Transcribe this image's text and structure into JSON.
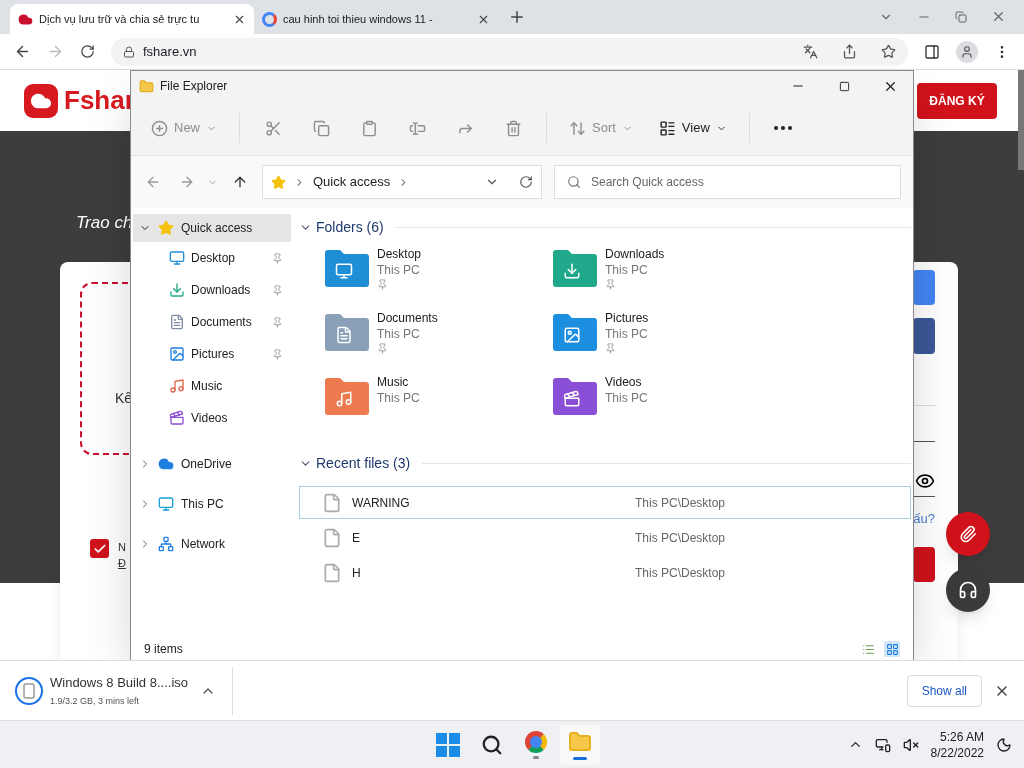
{
  "browser": {
    "tabs": [
      {
        "title": "Dịch vụ lưu trữ và chia sẻ trực tu",
        "selected": true
      },
      {
        "title": "cau hinh toi thieu windows 11 -",
        "selected": false
      }
    ],
    "address": "fshare.vn"
  },
  "page": {
    "logo": "Fshar",
    "register_button": "ĐĂNG KÝ",
    "tagline": "Trao ch",
    "drop_zone_text": "Kế",
    "agree": {
      "checked": true,
      "line_1": "N",
      "line_2": "Đ"
    },
    "link_text": "ấu?"
  },
  "explorer": {
    "title": "File Explorer",
    "toolbar": [
      {
        "kind": "new",
        "label": "New",
        "disabled": true
      },
      {
        "kind": "cut",
        "disabled": true
      },
      {
        "kind": "copy",
        "disabled": true
      },
      {
        "kind": "paste",
        "disabled": true
      },
      {
        "kind": "rename",
        "disabled": true
      },
      {
        "kind": "share",
        "disabled": true
      },
      {
        "kind": "delete",
        "disabled": true
      },
      {
        "kind": "sort",
        "label": "Sort",
        "disabled": true
      },
      {
        "kind": "view",
        "label": "View",
        "disabled": false
      },
      {
        "kind": "more",
        "disabled": false
      }
    ],
    "breadcrumb": "Quick access",
    "search_placeholder": "Search Quick access",
    "sidebar": [
      {
        "kind": "quick",
        "label": "Quick access",
        "expanded": true,
        "selected": true,
        "children": [
          {
            "kind": "desktop",
            "label": "Desktop",
            "pinned": true,
            "selected": false
          },
          {
            "kind": "downloads",
            "label": "Downloads",
            "pinned": true,
            "selected": false
          },
          {
            "kind": "documents",
            "label": "Documents",
            "pinned": true,
            "selected": false
          },
          {
            "kind": "pictures",
            "label": "Pictures",
            "pinned": true,
            "selected": false
          },
          {
            "kind": "music",
            "label": "Music",
            "pinned": false,
            "selected": false
          },
          {
            "kind": "videos",
            "label": "Videos",
            "pinned": false,
            "selected": false
          }
        ]
      },
      {
        "kind": "onedrive",
        "label": "OneDrive",
        "expanded": false,
        "selected": false
      },
      {
        "kind": "pc",
        "label": "This PC",
        "expanded": false,
        "selected": false
      },
      {
        "kind": "network",
        "label": "Network",
        "expanded": false,
        "selected": false
      }
    ],
    "folders": {
      "title": "Folders (6)",
      "expanded": true,
      "items": [
        {
          "kind": "desktop",
          "name": "Desktop",
          "location": "This PC",
          "pinned": true
        },
        {
          "kind": "downloads",
          "name": "Downloads",
          "location": "This PC",
          "pinned": true
        },
        {
          "kind": "documents",
          "name": "Documents",
          "location": "This PC",
          "pinned": true
        },
        {
          "kind": "pictures",
          "name": "Pictures",
          "location": "This PC",
          "pinned": true
        },
        {
          "kind": "music",
          "name": "Music",
          "location": "This PC",
          "pinned": false
        },
        {
          "kind": "videos",
          "name": "Videos",
          "location": "This PC",
          "pinned": false
        }
      ]
    },
    "recent": {
      "title": "Recent files (3)",
      "expanded": true,
      "items": [
        {
          "name": "WARNING",
          "location": "This PC\\Desktop",
          "selected": true
        },
        {
          "name": "E",
          "location": "This PC\\Desktop",
          "selected": false
        },
        {
          "name": "H",
          "location": "This PC\\Desktop",
          "selected": false
        }
      ]
    },
    "status": "9 items",
    "views": [
      {
        "kind": "details",
        "selected": false
      },
      {
        "kind": "tiles",
        "selected": true
      }
    ]
  },
  "download": {
    "file": "Windows 8 Build 8....iso",
    "progress": "1.9/3.2 GB, 3 mins left",
    "show_all": "Show all"
  },
  "taskbar": {
    "apps": [
      {
        "kind": "start"
      },
      {
        "kind": "search"
      },
      {
        "kind": "chrome",
        "active": false
      },
      {
        "kind": "explorer",
        "active": true
      }
    ],
    "time": "5:26 AM",
    "date": "8/22/2022"
  }
}
